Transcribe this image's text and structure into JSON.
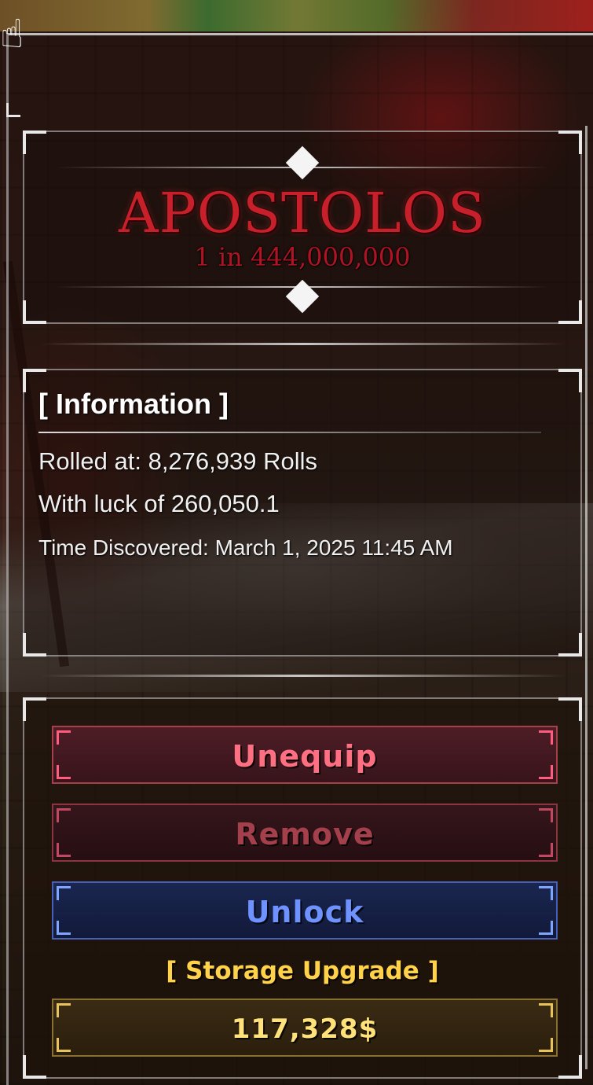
{
  "aura": {
    "name": "APOSTOLOS",
    "odds": "1 in 444,000,000"
  },
  "information": {
    "title": "[ Information ]",
    "rolled_at": "Rolled at: 8,276,939 Rolls",
    "luck": "With luck of 260,050.1",
    "time_discovered": "Time Discovered: March 1, 2025 11:45 AM"
  },
  "actions": {
    "unequip_label": "Unequip",
    "remove_label": "Remove",
    "unlock_label": "Unlock",
    "storage_upgrade_label": "[ Storage Upgrade ]",
    "storage_upgrade_price": "117,328$"
  },
  "colors": {
    "aura_red": "#c8202a",
    "unequip": "#ff6f82",
    "remove": "#a4404c",
    "unlock": "#6e92ff",
    "storage_gold": "#ffd24a"
  },
  "icons": {
    "cursor": "hand-cursor-icon",
    "selector_up": "arrow-up-diamond-icon",
    "selector_down": "arrow-down-diamond-icon"
  }
}
